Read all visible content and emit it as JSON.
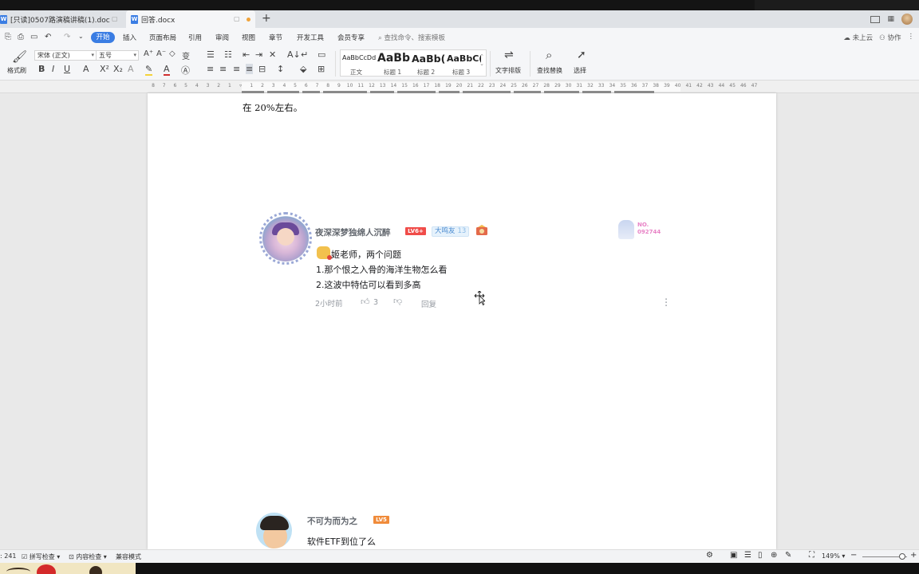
{
  "tabs": [
    {
      "label": "[只读]0507路演稿讲稿(1).doc",
      "icon": "word-doc-icon"
    },
    {
      "label": "回答.docx",
      "icon": "word-doc-icon"
    }
  ],
  "menu": {
    "items": [
      "开始",
      "插入",
      "页面布局",
      "引用",
      "审阅",
      "视图",
      "章节",
      "开发工具",
      "会员专享"
    ],
    "search_placeholder": "查找命令、搜索模板",
    "cloud_status": "未上云",
    "collab": "协作"
  },
  "ribbon": {
    "format_painter": "格式刷",
    "font_name": "宋体 (正文)",
    "font_size": "五号",
    "styles": [
      {
        "sample": "AaBbCcDd",
        "name": "正文"
      },
      {
        "sample": "AaBb",
        "name": "标题 1"
      },
      {
        "sample": "AaBb(",
        "name": "标题 2"
      },
      {
        "sample": "AaBbC(",
        "name": "标题 3"
      }
    ],
    "text_layout": "文字排版",
    "find_replace": "查找替换",
    "select": "选择"
  },
  "ruler": {
    "ticks": [
      "8",
      "7",
      "6",
      "5",
      "4",
      "3",
      "2",
      "1",
      "",
      "1",
      "2",
      "3",
      "4",
      "5",
      "6",
      "7",
      "8",
      "9",
      "10",
      "11",
      "12",
      "13",
      "14",
      "15",
      "16",
      "17",
      "18",
      "19",
      "20",
      "21",
      "22",
      "23",
      "24",
      "25",
      "26",
      "27",
      "28",
      "29",
      "30",
      "31",
      "32",
      "33",
      "34",
      "35",
      "36",
      "37",
      "38",
      "39",
      "40",
      "41",
      "42",
      "43",
      "44",
      "45",
      "46",
      "47"
    ]
  },
  "document": {
    "para_tail": "在 20%左右。",
    "comment1": {
      "username": "夜深深梦独绵人沉醉",
      "level_badge": "LV6+",
      "fan_badge": "大鸣友",
      "fan_level": "13",
      "card_no_label": "NO.",
      "card_no": "092744",
      "lines": [
        "姬老师，两个问题",
        "1.那个恨之入骨的海洋生物怎么看",
        "2.这波中特估可以看到多高"
      ],
      "time": "2小时前",
      "likes": "3",
      "reply": "回复"
    },
    "comment2": {
      "username": "不可为而为之",
      "level_badge": "LV5",
      "text": "软件ETF到位了么"
    }
  },
  "status": {
    "word_count": ": 241",
    "spell_check": "拼写检查",
    "content_check": "内容检查",
    "compat_mode": "兼容模式",
    "zoom": "149%"
  },
  "colors": {
    "accent": "#3a7de3",
    "lv6": "#f04c49",
    "lv5": "#f08b3a",
    "meta_gray": "#9499a0"
  }
}
